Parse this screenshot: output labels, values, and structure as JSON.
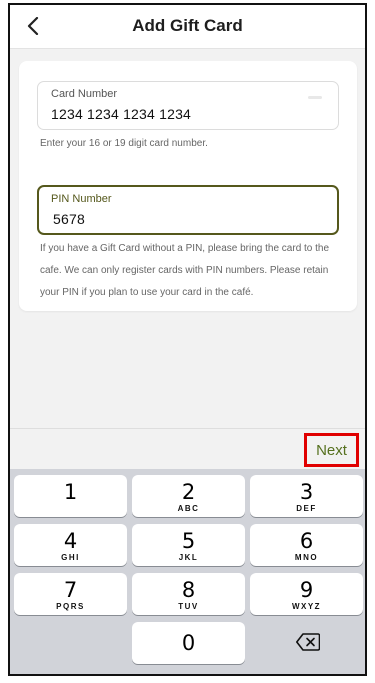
{
  "header": {
    "title": "Add Gift Card"
  },
  "form": {
    "card_number_label": "Card Number",
    "card_number_value": "1234 1234 1234 1234",
    "card_number_helper": "Enter your 16 or 19 digit card number.",
    "pin_label": "PIN Number",
    "pin_value": "5678",
    "pin_note": "If you have a Gift Card without a PIN, please bring the card to the cafe. We can only register cards with PIN numbers. Please retain your PIN if you plan to use your card in the café."
  },
  "accessory": {
    "next_label": "Next"
  },
  "keypad": {
    "keys": [
      {
        "digit": "1",
        "letters": ""
      },
      {
        "digit": "2",
        "letters": "ABC"
      },
      {
        "digit": "3",
        "letters": "DEF"
      },
      {
        "digit": "4",
        "letters": "GHI"
      },
      {
        "digit": "5",
        "letters": "JKL"
      },
      {
        "digit": "6",
        "letters": "MNO"
      },
      {
        "digit": "7",
        "letters": "PQRS"
      },
      {
        "digit": "8",
        "letters": "TUV"
      },
      {
        "digit": "9",
        "letters": "WXYZ"
      },
      {
        "digit": "0",
        "letters": ""
      }
    ]
  },
  "colors": {
    "accent": "#55581c",
    "next_text": "#55701e",
    "highlight": "#e00000",
    "keypad_bg": "#d1d3d9"
  },
  "icons": {
    "back": "chevron-left-icon",
    "delete": "backspace-icon"
  }
}
